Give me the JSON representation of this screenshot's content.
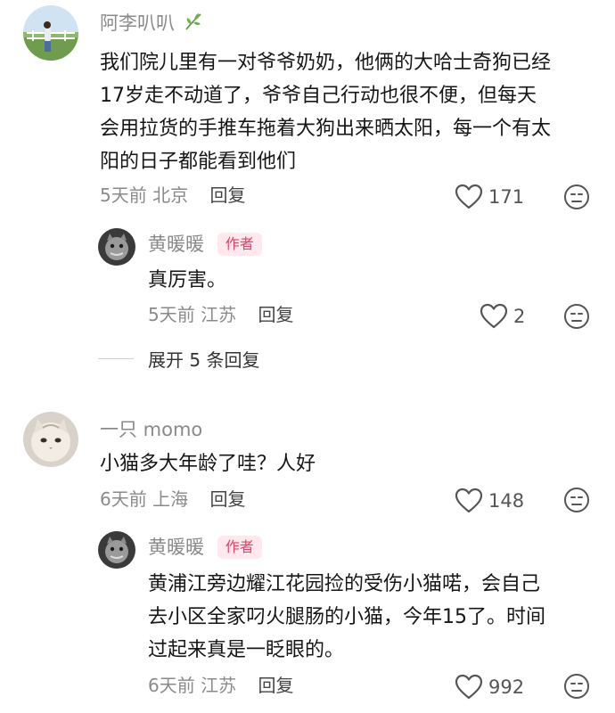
{
  "comments": [
    {
      "username": "阿李叭叭",
      "username_badge_icon": "leaf-icon",
      "text_lines": [
        "我们院儿里有一对爷爷奶奶，他俩的大哈士奇狗已经",
        "17岁走不动道了，爷爷自己行动也很不便，但每天",
        "会用拉货的手推车拖着大狗出来晒太阳，每一个有太",
        "阳的日子都能看到他们"
      ],
      "time": "5天前",
      "location": "北京",
      "reply_label": "回复",
      "likes": "171",
      "replies": [
        {
          "username": "黄暖暖",
          "author_tag": "作者",
          "text_lines": [
            "真厉害。"
          ],
          "time": "5天前",
          "location": "江苏",
          "reply_label": "回复",
          "likes": "2"
        }
      ],
      "expand_label": "展开 5 条回复"
    },
    {
      "username": "一只 momo",
      "text_lines": [
        "小猫多大年龄了哇？人好"
      ],
      "time": "6天前",
      "location": "上海",
      "reply_label": "回复",
      "likes": "148",
      "replies": [
        {
          "username": "黄暖暖",
          "author_tag": "作者",
          "text_lines": [
            "黄浦江旁边耀江花园捡的受伤小猫喏，会自己",
            "去小区全家叼火腿肠的小猫，今年15了。时间",
            "过起来真是一眨眼的。"
          ],
          "time": "6天前",
          "location": "江苏",
          "reply_label": "回复",
          "likes": "992"
        }
      ]
    }
  ],
  "colors": {
    "username": "#8a8a8a",
    "author_tag_bg": "#ffe9ee",
    "author_tag_text": "#ef3e64",
    "body_text": "#161616"
  }
}
